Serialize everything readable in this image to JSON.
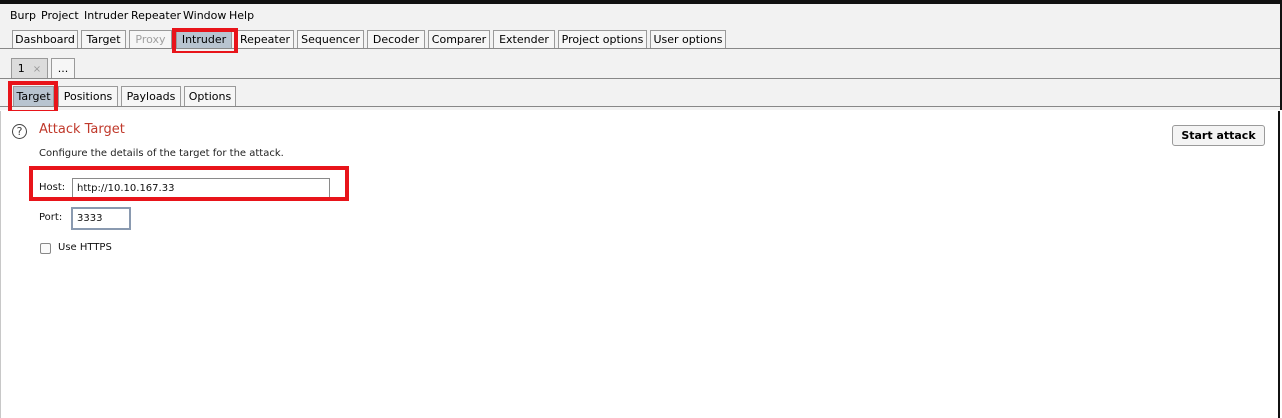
{
  "menu": [
    "Burp",
    "Project",
    "Intruder",
    "Repeater",
    "Window",
    "Help"
  ],
  "main_tabs": [
    "Dashboard",
    "Target",
    "Proxy",
    "Intruder",
    "Repeater",
    "Sequencer",
    "Decoder",
    "Comparer",
    "Extender",
    "Project options",
    "User options"
  ],
  "main_tab_states": {
    "disabled": "Proxy",
    "selected": "Intruder"
  },
  "attack_tabs": {
    "tab1": "1",
    "close": "×",
    "new": "..."
  },
  "config_tabs": [
    "Target",
    "Positions",
    "Payloads",
    "Options"
  ],
  "config_tab_selected": "Target",
  "attack_target": {
    "help_glyph": "?",
    "title": "Attack Target",
    "description": "Configure the details of the target for the attack.",
    "host_label": "Host:",
    "host_value": "http://10.10.167.33",
    "port_label": "Port:",
    "port_value": "3333",
    "https_label": "Use HTTPS",
    "https_checked": false,
    "start_button": "Start attack"
  },
  "colors": {
    "title": "#c0392b",
    "highlight": "#e8141a",
    "selected_tab": "#b8c4d0"
  }
}
